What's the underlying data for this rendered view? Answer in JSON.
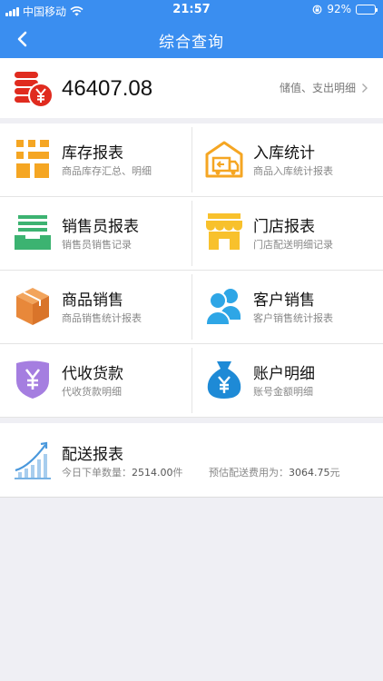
{
  "status_bar": {
    "carrier": "中国移动",
    "time": "21:57",
    "battery": "92%",
    "battery_level": 0.92
  },
  "nav": {
    "title": "综合查询",
    "back_icon": "chevron-left-icon"
  },
  "balance": {
    "amount": "46407.08",
    "link_label": "储值、支出明细",
    "icon": "coins-yen-icon"
  },
  "grid": [
    {
      "title": "库存报表",
      "subtitle": "商品库存汇总、明细",
      "icon": "inventory-grid-icon",
      "color": "#f5a623"
    },
    {
      "title": "入库统计",
      "subtitle": "商品入库统计报表",
      "icon": "warehouse-truck-icon",
      "color": "#f5a623"
    },
    {
      "title": "销售员报表",
      "subtitle": "销售员销售记录",
      "icon": "inbox-tray-icon",
      "color": "#3cb371"
    },
    {
      "title": "门店报表",
      "subtitle": "门店配送明细记录",
      "icon": "storefront-icon",
      "color": "#f8c12c"
    },
    {
      "title": "商品销售",
      "subtitle": "商品销售统计报表",
      "icon": "package-box-icon",
      "color": "#e8883a"
    },
    {
      "title": "客户销售",
      "subtitle": "客户销售统计报表",
      "icon": "customers-icon",
      "color": "#2ea6e6"
    },
    {
      "title": "代收货款",
      "subtitle": "代收货款明细",
      "icon": "yen-shield-icon",
      "color": "#a57ee0"
    },
    {
      "title": "账户明细",
      "subtitle": "账号金额明细",
      "icon": "money-bag-icon",
      "color": "#1e8ad6"
    }
  ],
  "delivery": {
    "title": "配送报表",
    "orders_label": "今日下单数量：",
    "orders_value": "2514.00",
    "orders_unit": "件",
    "fee_label": "预估配送费用为：",
    "fee_value": "3064.75",
    "fee_unit": "元",
    "icon": "growth-chart-icon"
  }
}
